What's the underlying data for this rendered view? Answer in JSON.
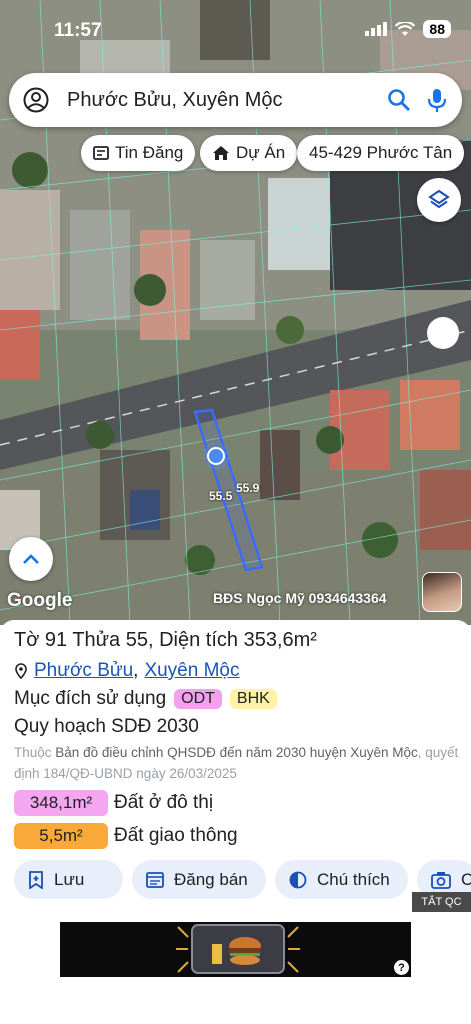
{
  "status": {
    "time": "11:57",
    "battery": "88"
  },
  "search": {
    "text": "Phước Bửu, Xuyên Mộc"
  },
  "chips": [
    {
      "label": "Tin Đăng",
      "icon": "news-icon"
    },
    {
      "label": "Dự Án",
      "icon": "house-icon"
    },
    {
      "label": "45-429 Phước Tân",
      "icon": ""
    }
  ],
  "map": {
    "google": "Google",
    "seller": "BĐS Ngọc Mỹ 0934643364",
    "dim_a": "55.9",
    "dim_b": "55.5"
  },
  "parcel": {
    "title": "Tờ 91 Thửa 55, Diện tích 353,6m²",
    "commune": "Phước Bửu",
    "district": "Xuyên Mộc",
    "separator": ",",
    "purpose_label": "Mục đích sử dụng",
    "purpose_codes": [
      {
        "code": "ODT",
        "color": "#f3a0ee"
      },
      {
        "code": "BHK",
        "color": "#fff1a8"
      }
    ],
    "plan_label": "Quy hoạch SDĐ 2030",
    "source_prefix": "Thuộc",
    "source_text": "Bản đồ điều chỉnh QHSDĐ đến năm 2030 huyện Xuyên Mộc",
    "source_suffix": ", quyết định 184/QĐ-UBND ngày 26/03/2025",
    "land_types": [
      {
        "area": "348,1m²",
        "name": "Đất ở đô thị",
        "color": "#f4a6f0"
      },
      {
        "area": "5,5m²",
        "name": "Đất giao thông",
        "color": "#f8a938"
      }
    ]
  },
  "actions": [
    {
      "label": "Lưu",
      "icon": "save-icon"
    },
    {
      "label": "Đăng bán",
      "icon": "listing-icon"
    },
    {
      "label": "Chú thích",
      "icon": "contrast-icon"
    },
    {
      "label": "C",
      "icon": "camera-icon"
    }
  ],
  "ad": {
    "close_label": "TẮT QC",
    "help": "?"
  },
  "colors": {
    "accent": "#1a73e8",
    "action_bg": "#e8effa",
    "parcel_outline": "#3b6bff"
  }
}
